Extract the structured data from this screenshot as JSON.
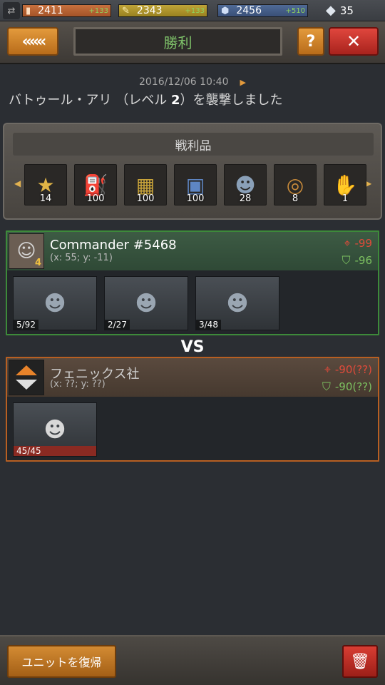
{
  "resources": {
    "oil": {
      "value": "2411",
      "bonus": "+133",
      "icon": "oil-icon"
    },
    "ammo": {
      "value": "2343",
      "bonus": "+133",
      "icon": "ammo-icon"
    },
    "steel": {
      "value": "2456",
      "bonus": "+510",
      "icon": "steel-icon"
    },
    "gems": {
      "value": "35",
      "icon": "diamond-icon"
    }
  },
  "header": {
    "title": "勝利",
    "back_label": "«««",
    "help_label": "?",
    "close_label": "✕"
  },
  "battle": {
    "timestamp": "2016/12/06 10:40",
    "desc_prefix": "バトゥール・アリ （レベル ",
    "desc_level": "2",
    "desc_suffix": "）を襲撃しました"
  },
  "loot": {
    "title": "戦利品",
    "items": [
      {
        "icon": "star-medal-icon",
        "glyph": "★",
        "count": "14",
        "color": "#e0b446"
      },
      {
        "icon": "fuel-can-icon",
        "glyph": "⛽",
        "count": "100",
        "color": "#d8402d"
      },
      {
        "icon": "ammo-crate-icon",
        "glyph": "▦",
        "count": "100",
        "color": "#c9a43a"
      },
      {
        "icon": "steel-crate-icon",
        "glyph": "▣",
        "count": "100",
        "color": "#5e86c4"
      },
      {
        "icon": "soldier-portrait-icon",
        "glyph": "☻",
        "count": "28",
        "color": "#8aa0b8"
      },
      {
        "icon": "target-icon",
        "glyph": "◎",
        "count": "8",
        "color": "#c88a3a"
      },
      {
        "icon": "glove-icon",
        "glyph": "✋",
        "count": "1",
        "color": "#a8a878"
      }
    ]
  },
  "attacker": {
    "name": "Commander #5468",
    "coords": "(x: 55; y: -11)",
    "level": "4",
    "attack": "-99",
    "defense": "-96",
    "units": [
      {
        "count": "5/92",
        "icon": "spec-ops-soldier-icon"
      },
      {
        "count": "2/27",
        "icon": "masked-soldier-icon"
      },
      {
        "count": "3/48",
        "icon": "goggles-soldier-icon"
      }
    ]
  },
  "vs_label": "VS",
  "defender": {
    "name": "フェニックス社",
    "coords": "(x: ??; y: ??)",
    "attack": "-90(??)",
    "defense": "-90(??)",
    "units": [
      {
        "count": "45/45",
        "hp": 1.0,
        "icon": "gas-mask-soldier-icon"
      }
    ]
  },
  "footer": {
    "restore_label": "ユニットを復帰",
    "trash_label": "🗑"
  }
}
